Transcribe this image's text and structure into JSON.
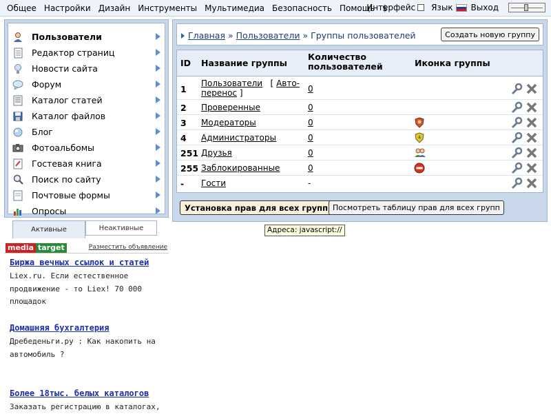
{
  "topbar": {
    "menu": [
      "Общее",
      "Настройки",
      "Дизайн",
      "Инструменты",
      "Мультимедиа",
      "Безопасность",
      "Помощь",
      "$"
    ],
    "interface_label": "Интерфейс",
    "language_label": "Язык",
    "logout_label": "Выход"
  },
  "sidebar": {
    "items": [
      {
        "label": "Пользователи",
        "icon": "user-icon"
      },
      {
        "label": "Редактор страниц",
        "icon": "page-icon"
      },
      {
        "label": "Новости сайта",
        "icon": "bulb-icon"
      },
      {
        "label": "Форум",
        "icon": "forum-icon"
      },
      {
        "label": "Каталог статей",
        "icon": "articles-icon"
      },
      {
        "label": "Каталог файлов",
        "icon": "disk-icon"
      },
      {
        "label": "Блог",
        "icon": "blog-icon"
      },
      {
        "label": "Фотоальбомы",
        "icon": "camera-icon"
      },
      {
        "label": "Гостевая книга",
        "icon": "guestbook-icon"
      },
      {
        "label": "Поиск по сайту",
        "icon": "search-icon"
      },
      {
        "label": "Почтовые формы",
        "icon": "mail-icon"
      },
      {
        "label": "Опросы",
        "icon": "poll-icon"
      }
    ]
  },
  "tabs": {
    "active": "Активные",
    "inactive": "Неактивные"
  },
  "ad": {
    "logo_part1": "media",
    "logo_part2": "target",
    "place_link": "Разместить объявление",
    "items": [
      {
        "title": "Биржа вечных ссылок и статей",
        "lines": [
          "Liex.ru. Если естественное",
          "продвижение - то Liex! 70 000",
          "площадок"
        ]
      },
      {
        "title": "Домашняя бухгалтерия",
        "lines": [
          "Дребеденьги.ру : Как накопить на",
          "автомобиль ?"
        ]
      },
      {
        "title": "Более 18тыс. белых каталогов",
        "lines": [
          "Заказать регистрацию в каталогах,"
        ]
      }
    ]
  },
  "breadcrumb": {
    "home": "Главная",
    "users": "Пользователи",
    "current": "Группы пользователей",
    "sep": "»"
  },
  "create_button": "Создать новую группу",
  "table": {
    "headers": {
      "id": "ID",
      "name": "Название группы",
      "count_line1": "Количество",
      "count_line2": "пользователей",
      "icon": "Иконка группы"
    },
    "rows": [
      {
        "id": "1",
        "name": "Пользователи",
        "extra_link_line1": "Авто-",
        "extra_link_line2": "перенос",
        "count": "0",
        "icon": ""
      },
      {
        "id": "2",
        "name": "Проверенные",
        "count": "0",
        "icon": ""
      },
      {
        "id": "3",
        "name": "Модераторы",
        "count": "0",
        "icon": "moderator-shield-icon"
      },
      {
        "id": "4",
        "name": "Администраторы",
        "count": "0",
        "icon": "admin-shield-icon"
      },
      {
        "id": "251",
        "name": "Друзья",
        "count": "0",
        "icon": "friends-icon"
      },
      {
        "id": "255",
        "name": "Заблокированные",
        "count": "0",
        "icon": "blocked-icon"
      },
      {
        "id": "-",
        "name": "Гости",
        "count": "-",
        "icon": ""
      }
    ]
  },
  "buttons": {
    "set_rights": "Установка прав для всех групп",
    "view_rights": "Посмотреть таблицу прав для всех групп"
  },
  "tooltip": "Адреса: javascript://"
}
